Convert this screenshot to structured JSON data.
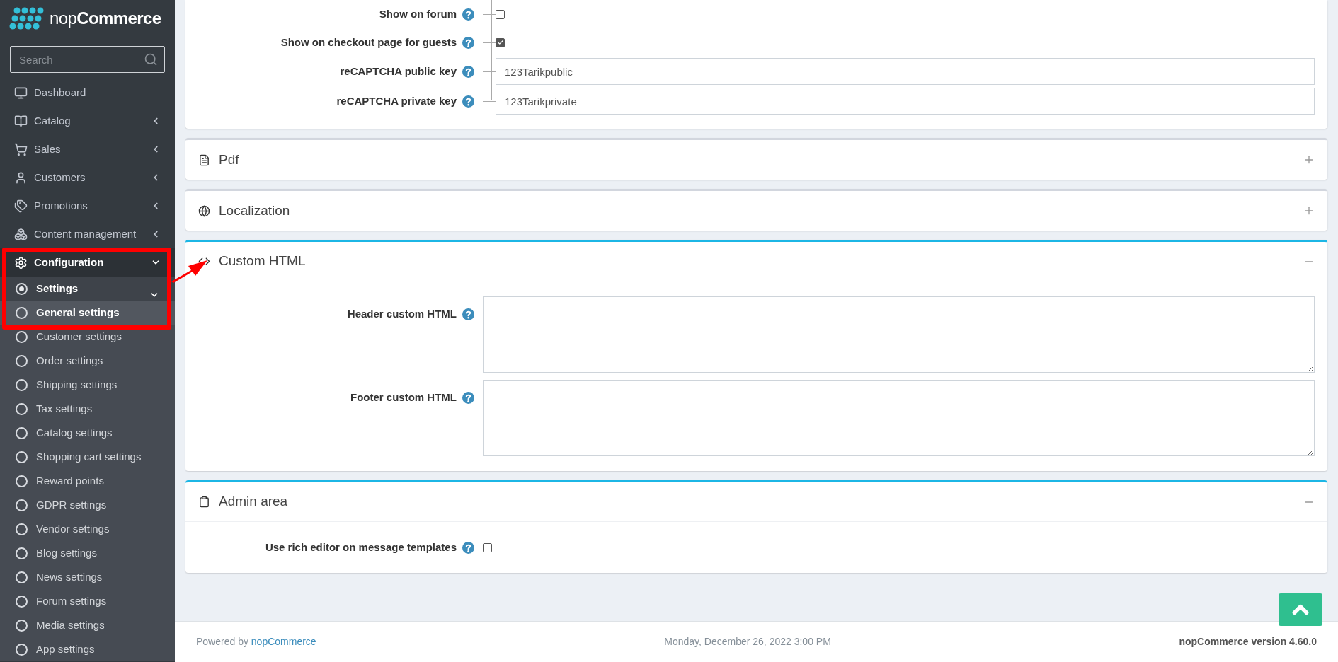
{
  "sidebar": {
    "logo": {
      "light": "nop",
      "bold": "Commerce"
    },
    "search": {
      "placeholder": "Search"
    },
    "items": [
      {
        "label": "Dashboard",
        "has_children": false,
        "expanded": false
      },
      {
        "label": "Catalog",
        "has_children": true,
        "expanded": false
      },
      {
        "label": "Sales",
        "has_children": true,
        "expanded": false
      },
      {
        "label": "Customers",
        "has_children": true,
        "expanded": false
      },
      {
        "label": "Promotions",
        "has_children": true,
        "expanded": false
      },
      {
        "label": "Content management",
        "has_children": true,
        "expanded": false
      },
      {
        "label": "Configuration",
        "has_children": true,
        "expanded": true,
        "children": [
          {
            "label": "Settings",
            "expanded": true,
            "selected": false,
            "children": [
              {
                "label": "General settings",
                "selected": true
              },
              {
                "label": "Customer settings",
                "selected": false
              },
              {
                "label": "Order settings",
                "selected": false
              },
              {
                "label": "Shipping settings",
                "selected": false
              },
              {
                "label": "Tax settings",
                "selected": false
              },
              {
                "label": "Catalog settings",
                "selected": false
              },
              {
                "label": "Shopping cart settings",
                "selected": false
              },
              {
                "label": "Reward points",
                "selected": false
              },
              {
                "label": "GDPR settings",
                "selected": false
              },
              {
                "label": "Vendor settings",
                "selected": false
              },
              {
                "label": "Blog settings",
                "selected": false
              },
              {
                "label": "News settings",
                "selected": false
              },
              {
                "label": "Forum settings",
                "selected": false
              },
              {
                "label": "Media settings",
                "selected": false
              },
              {
                "label": "App settings",
                "selected": false
              }
            ]
          }
        ]
      }
    ]
  },
  "sections": [
    {
      "fields": [
        {
          "label": "Show on forum",
          "kind": "checkbox",
          "checked": false
        },
        {
          "label": "Show on checkout page for guests",
          "kind": "checkbox",
          "checked": true
        },
        {
          "label": "reCAPTCHA public key",
          "kind": "text",
          "value": "123Tarikpublic"
        },
        {
          "label": "reCAPTCHA private key",
          "kind": "text",
          "value": "123Tarikprivate"
        }
      ]
    },
    {
      "title": "Pdf",
      "expanded": false
    },
    {
      "title": "Localization",
      "expanded": false
    },
    {
      "title": "Custom HTML",
      "expanded": true,
      "fields": [
        {
          "label": "Header custom HTML",
          "kind": "textarea"
        },
        {
          "label": "Footer custom HTML",
          "kind": "textarea"
        }
      ]
    },
    {
      "title": "Admin area",
      "expanded": true,
      "fields": [
        {
          "label": "Use rich editor on message templates",
          "kind": "checkbox",
          "checked": false
        }
      ]
    }
  ],
  "footer": {
    "powered_by": "Powered by",
    "powered_link": "nopCommerce",
    "datetime": "Monday, December 26, 2022 3:00 PM",
    "version": "nopCommerce version 4.60.0"
  }
}
